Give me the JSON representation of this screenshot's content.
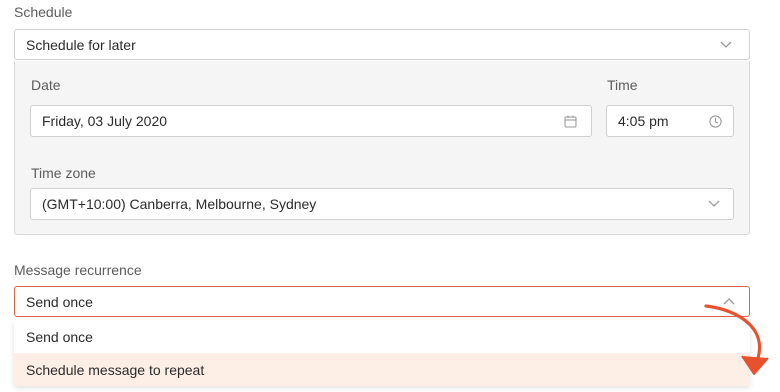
{
  "schedule": {
    "label": "Schedule",
    "selected": "Schedule for later"
  },
  "date": {
    "label": "Date",
    "value": "Friday, 03 July 2020",
    "icon": "calendar-icon"
  },
  "time": {
    "label": "Time",
    "value": "4:05 pm",
    "icon": "clock-icon"
  },
  "timezone": {
    "label": "Time zone",
    "value": "(GMT+10:00) Canberra, Melbourne, Sydney"
  },
  "recurrence": {
    "label": "Message recurrence",
    "selected": "Send once",
    "options": [
      "Send once",
      "Schedule message to repeat"
    ],
    "highlighted_option": "Schedule message to repeat"
  },
  "colors": {
    "focus_border": "#d9614a",
    "highlight_bg": "#fdeee6",
    "arrow": "#e8512e",
    "panel_bg": "#f5f5f5"
  }
}
